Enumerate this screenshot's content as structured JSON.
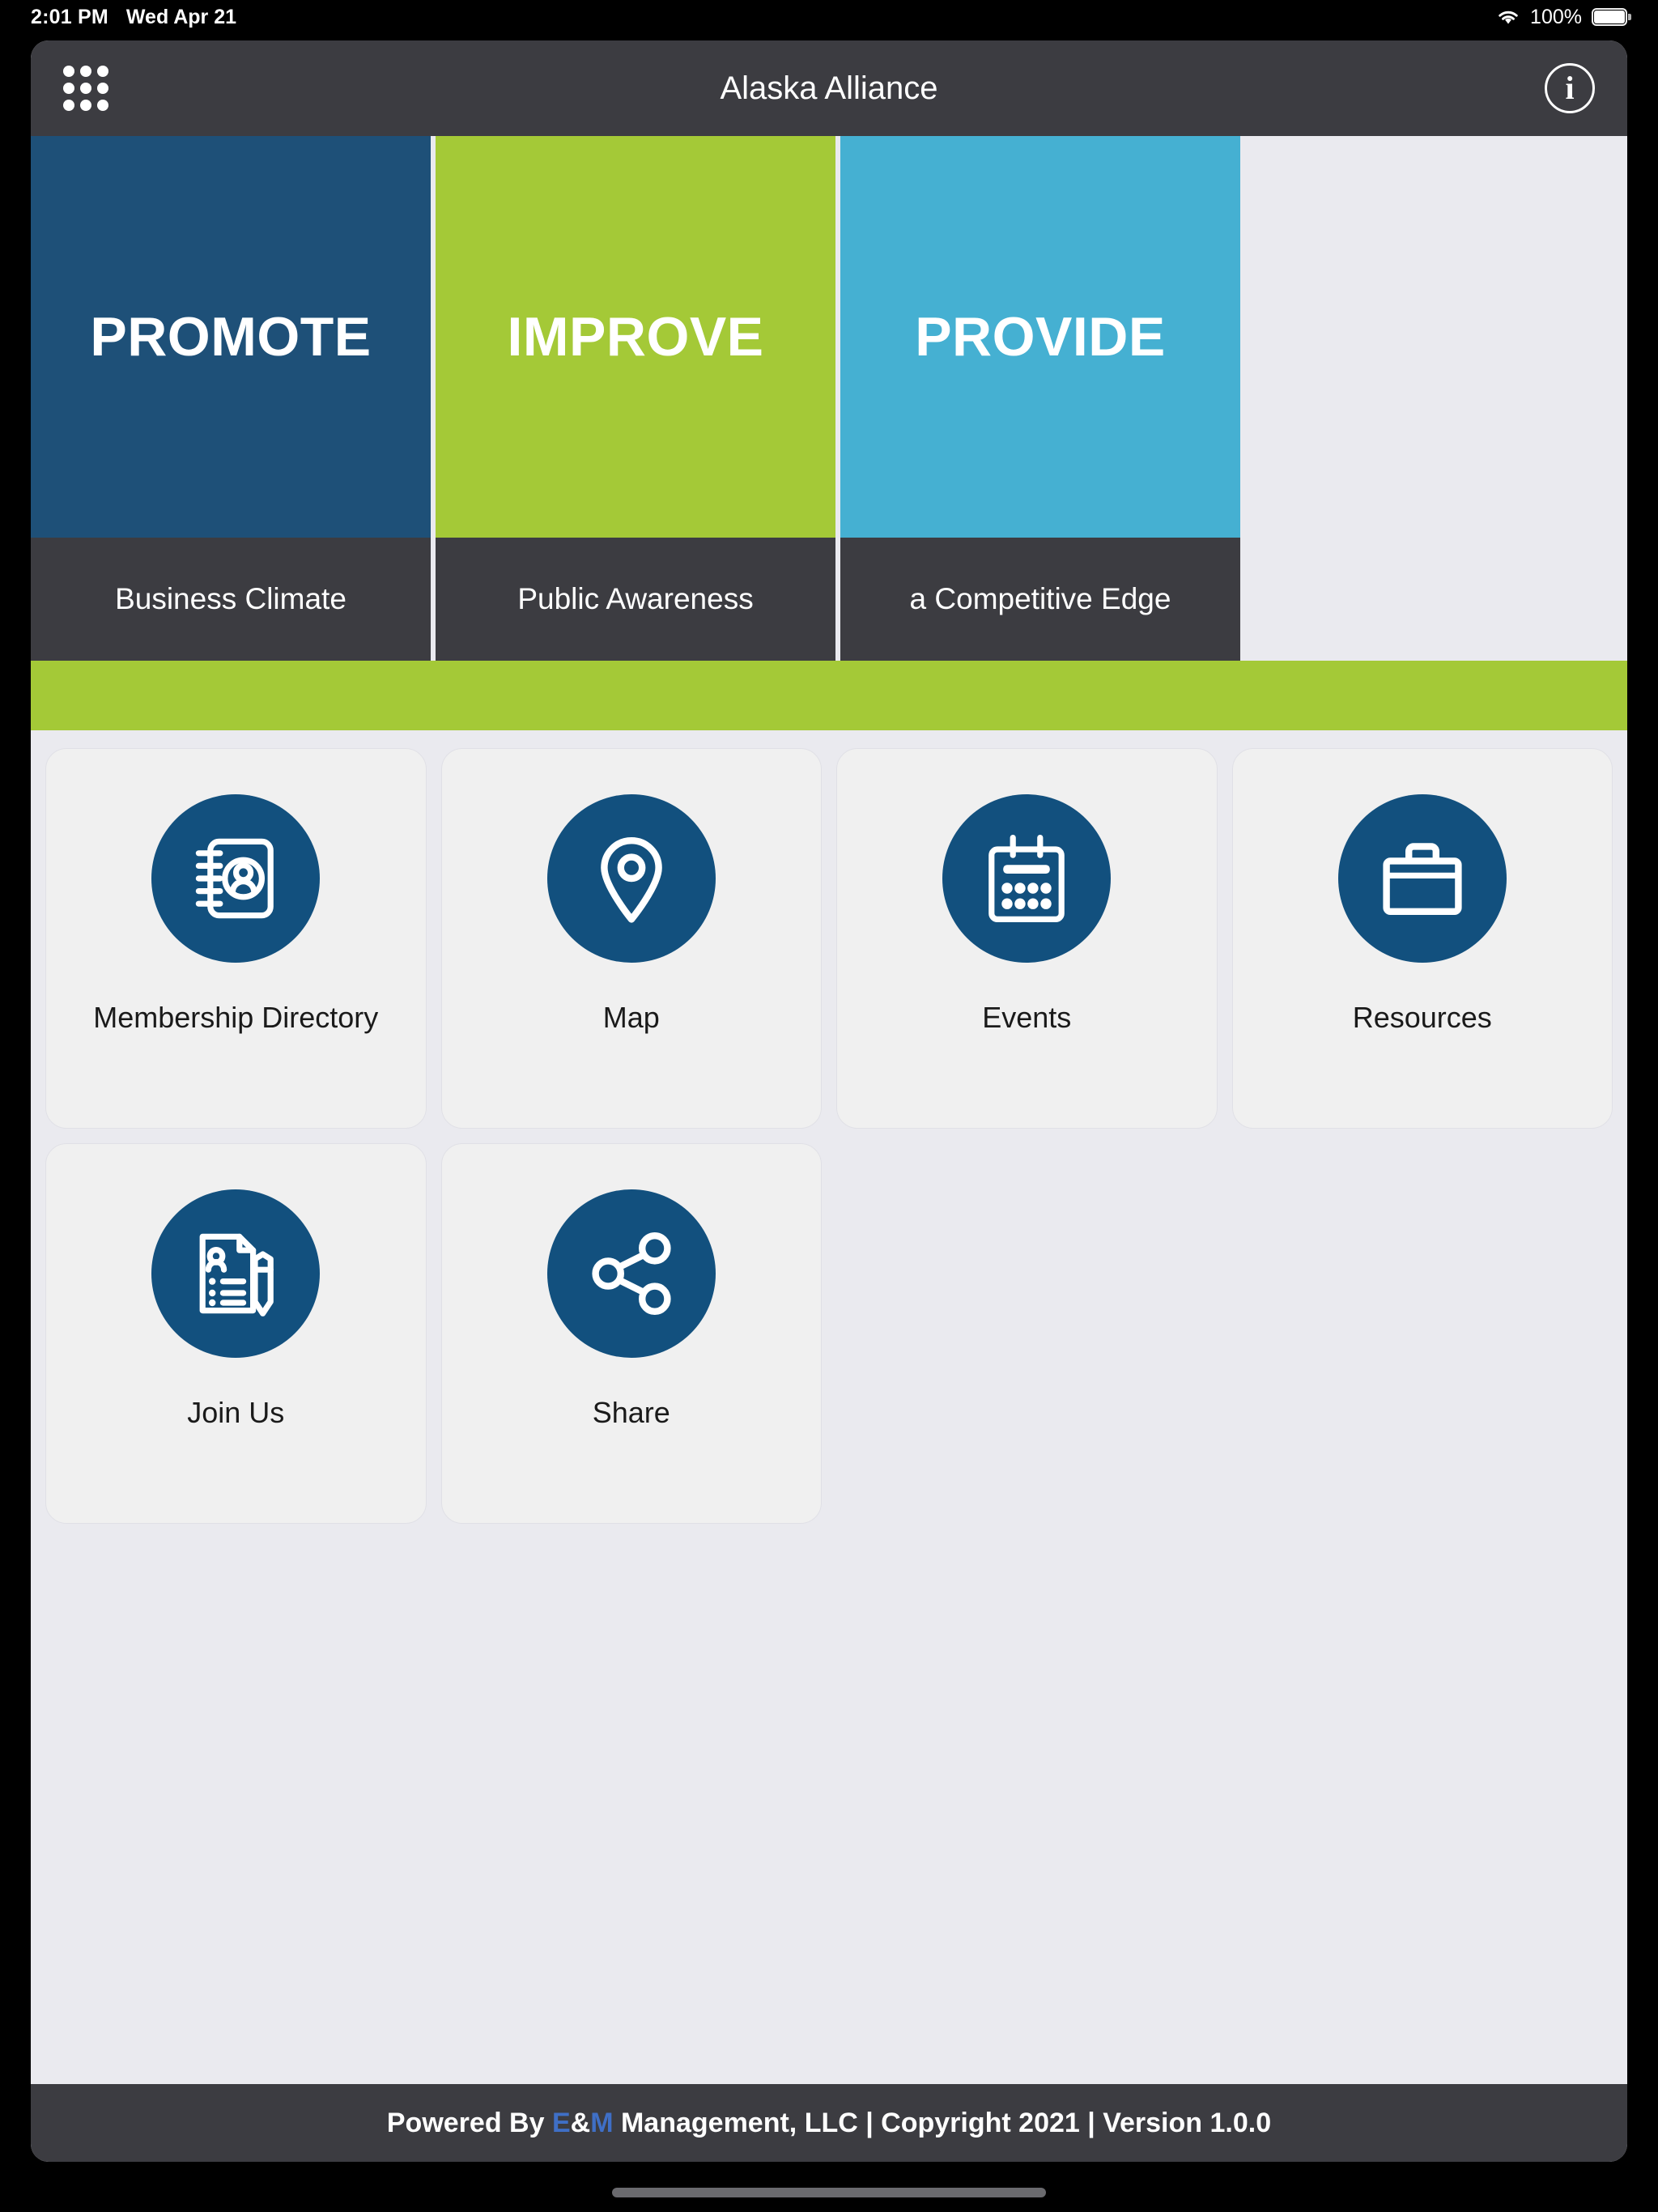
{
  "status_bar": {
    "time": "2:01 PM",
    "date": "Wed Apr 21",
    "wifi_icon": "wifi-icon",
    "battery_percent": "100%",
    "battery_icon": "battery-full-icon"
  },
  "nav": {
    "menu_icon": "grid-menu-icon",
    "title": "Alaska Alliance",
    "info_icon": "info-icon",
    "info_glyph": "i"
  },
  "banners": [
    {
      "word": "PROMOTE",
      "sub": "Business Climate",
      "color": "#1E5078"
    },
    {
      "word": "IMPROVE",
      "sub": "Public Awareness",
      "color": "#A4C937"
    },
    {
      "word": "PROVIDE",
      "sub": "a Competitive Edge",
      "color": "#45B0D2"
    }
  ],
  "divider": {
    "color": "#A4C937"
  },
  "tiles": [
    {
      "label": "Membership Directory",
      "icon": "address-book-icon",
      "circle_color": "#12507E"
    },
    {
      "label": "Map",
      "icon": "location-pin-icon",
      "circle_color": "#12507E"
    },
    {
      "label": "Events",
      "icon": "calendar-icon",
      "circle_color": "#12507E"
    },
    {
      "label": "Resources",
      "icon": "briefcase-icon",
      "circle_color": "#12507E"
    },
    {
      "label": "Join Us",
      "icon": "form-pencil-icon",
      "circle_color": "#12507E"
    },
    {
      "label": "Share",
      "icon": "share-nodes-icon",
      "circle_color": "#12507E"
    }
  ],
  "footer": {
    "prefix": "Powered By ",
    "brand_e": "E",
    "brand_amp": "&",
    "brand_m": "M",
    "suffix": " Management, LLC | Copyright 2021 | Version 1.0.0",
    "brand_color": "#3F6FC6"
  }
}
